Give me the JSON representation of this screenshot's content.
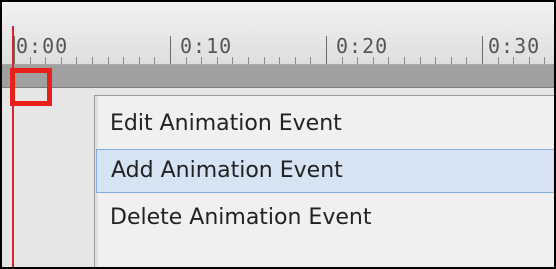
{
  "timeline": {
    "time_labels": [
      "0:00",
      "0:10",
      "0:20",
      "0:30"
    ]
  },
  "context_menu": {
    "items": [
      {
        "label": "Edit Animation Event",
        "selected": false
      },
      {
        "label": "Add Animation Event",
        "selected": true
      },
      {
        "label": "Delete Animation Event",
        "selected": false
      }
    ]
  },
  "colors": {
    "playhead": "#d22828",
    "highlight": "#e8201a",
    "menu_selection": "#d5e3f3"
  },
  "icons": [
    "playhead-marker"
  ]
}
